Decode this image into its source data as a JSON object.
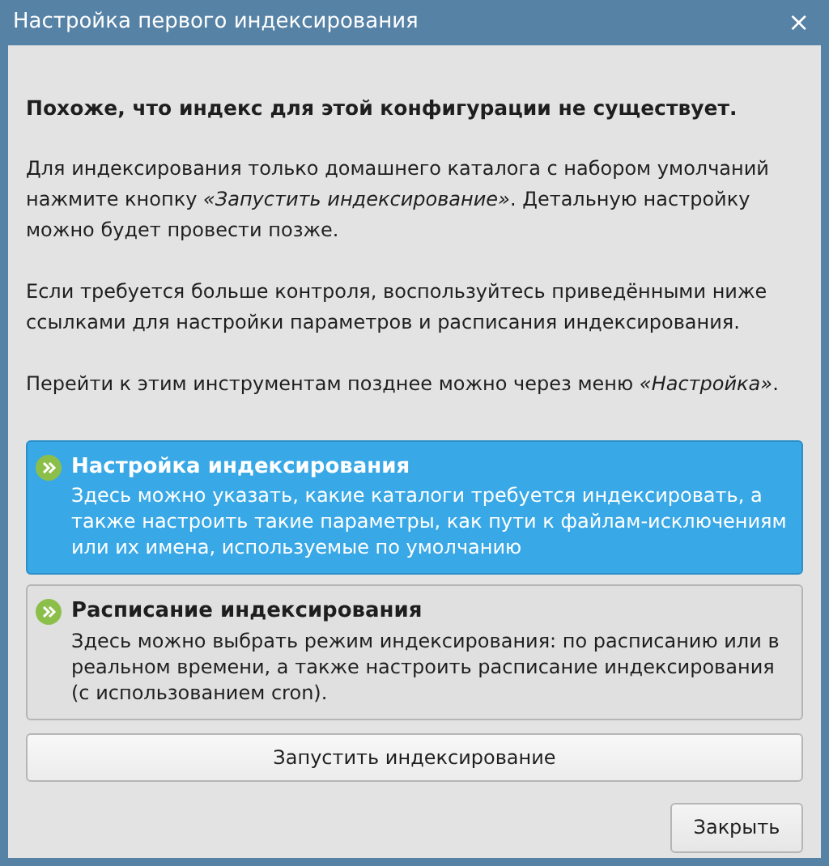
{
  "window": {
    "title": "Настройка первого индексирования",
    "close": "×"
  },
  "heading": "Похоже, что индекс для этой конфигурации не существует.",
  "paragraphs": [
    "Для индексирования только домашнего каталога с набором умолчаний нажмите кнопку *«Запустить индексирование»*. Детальную настройку можно будет провести позже.",
    "Если требуется больше контроля, воспользуйтесь приведёнными ниже ссылками для настройки параметров и расписания индексирования.",
    "Перейти к этим инструментам позднее можно через меню *«Настройка»*."
  ],
  "links": [
    {
      "title": "Настройка индексирования",
      "description": "Здесь можно указать, какие каталоги требуется индексировать, а также настроить такие параметры, как пути к файлам-исключениям или их имена, используемые по умолчанию",
      "selected": true
    },
    {
      "title": "Расписание индексирования",
      "description": "Здесь можно выбрать режим индексирования: по расписанию или в реальном времени, а также настроить расписание индексирования (с использованием cron).",
      "selected": false
    }
  ],
  "start_button": "Запустить индексирование",
  "close_button": "Закрыть"
}
